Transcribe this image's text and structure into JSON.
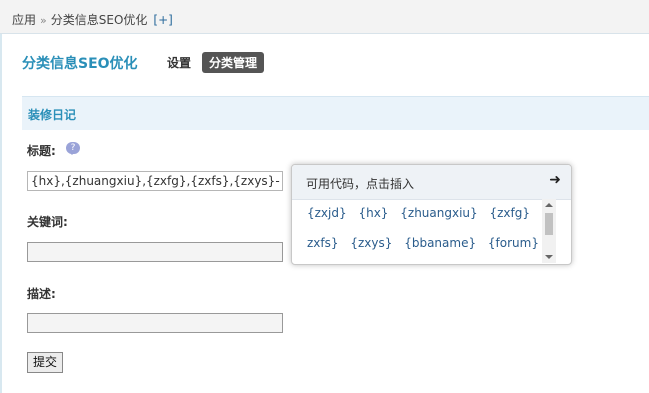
{
  "breadcrumb": {
    "home": "应用",
    "separator": "»",
    "current": "分类信息SEO优化",
    "add": "[+]"
  },
  "header": {
    "title": "分类信息SEO优化",
    "nav_settings": "设置",
    "nav_manage": "分类管理"
  },
  "section": {
    "title": "装修日记"
  },
  "form": {
    "title_label": "标题:",
    "title_value": "{hx},{zhuangxiu},{zxfg},{zxfs},{zxys}-",
    "keywords_label": "关键词:",
    "keywords_value": "",
    "description_label": "描述:",
    "description_value": "",
    "submit_label": "提交"
  },
  "popup": {
    "title": "可用代码，点击插入",
    "codes_line1": [
      "{zxjd}",
      "{hx}",
      "{zhuangxiu}",
      "{zxfg}",
      "{"
    ],
    "codes_line2": [
      "zxfs}",
      "{zxys}",
      "{bbaname}",
      "{forum}"
    ]
  },
  "icons": {
    "help": "help-bubble-icon",
    "arrow": "arrow-right-icon"
  },
  "colors": {
    "accent": "#2a8fb8",
    "nav_active_bg": "#555555",
    "section_bg": "#eaf3fa"
  }
}
